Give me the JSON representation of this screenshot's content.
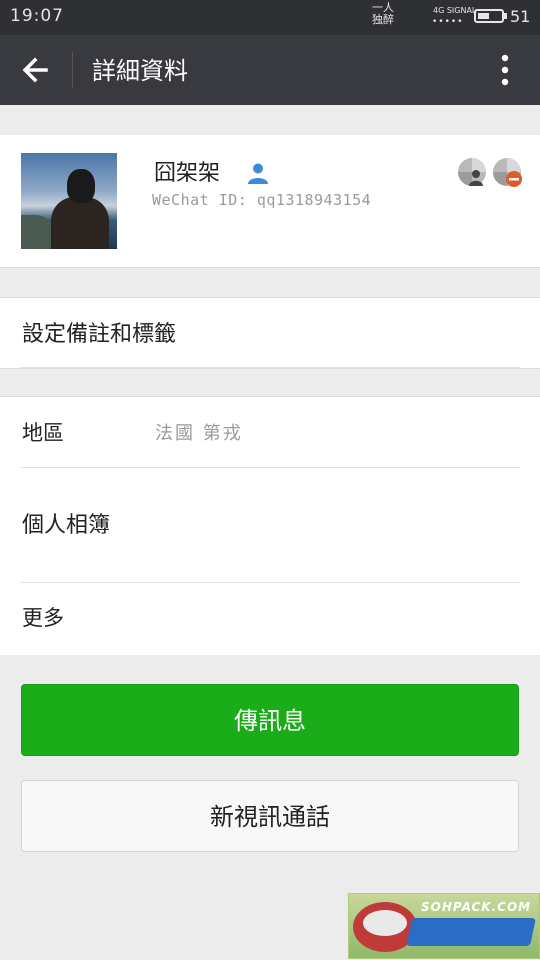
{
  "status_bar": {
    "time": "19:07",
    "carrier_line1": "一人",
    "carrier_line2": "独醉",
    "network": "4G SIGNAL",
    "signal_dots": "•••••",
    "battery_level": "51",
    "battery_fraction": 0.51
  },
  "title_bar": {
    "back_icon": "arrow-left-icon",
    "title": "詳細資料",
    "more_icon": "more-vertical-icon",
    "background": "#393a3f"
  },
  "profile": {
    "nickname": "囧架架",
    "wechat_id": "WeChat ID: qq1318943154",
    "contact_icon": "person-icon",
    "contact_icon_color": "#3d8ad8"
  },
  "remarks": {
    "label": "設定備註和標籤"
  },
  "info": {
    "region_label": "地區",
    "region_value": "法國 第戎",
    "album_label": "個人相簿",
    "more_label": "更多"
  },
  "actions": {
    "send_message": "傳訊息",
    "video_call": "新視訊通話",
    "primary_color": "#1aad19"
  },
  "watermark": {
    "text": "SOHPACK.COM"
  }
}
